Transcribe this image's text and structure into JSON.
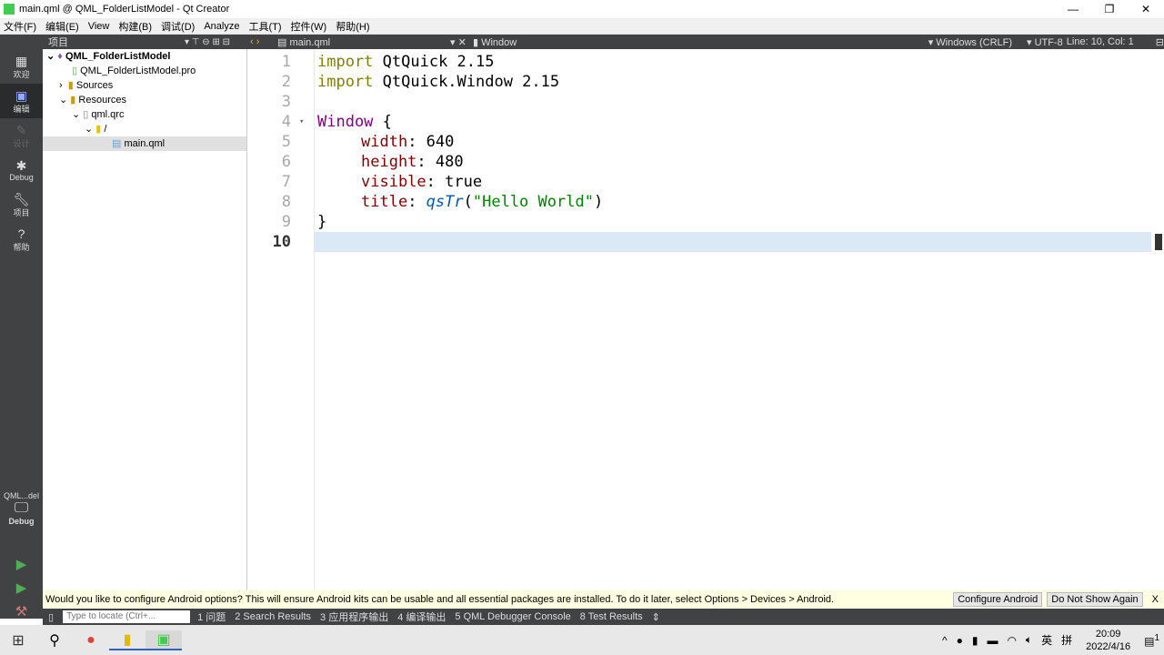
{
  "window": {
    "title": "main.qml @ QML_FolderListModel - Qt Creator",
    "logo": "QC"
  },
  "menu": [
    "文件(F)",
    "编辑(E)",
    "View",
    "构建(B)",
    "调试(D)",
    "Analyze",
    "工具(T)",
    "控件(W)",
    "帮助(H)"
  ],
  "modes": [
    {
      "label": "欢迎",
      "icon": "grid-icon"
    },
    {
      "label": "编辑",
      "icon": "edit-icon"
    },
    {
      "label": "设计",
      "icon": "pen-icon"
    },
    {
      "label": "Debug",
      "icon": "bug-icon"
    },
    {
      "label": "项目",
      "icon": "wrench-icon"
    },
    {
      "label": "帮助",
      "icon": "help-icon"
    }
  ],
  "kit": {
    "project": "QML...del",
    "config": "Debug"
  },
  "toolbar": {
    "panel_title": "项目",
    "file": "main.qml",
    "symbol": "Window",
    "line_ending": "Windows (CRLF)",
    "encoding": "UTF-8",
    "position": "Line: 10, Col: 1"
  },
  "tree": [
    {
      "label": "QML_FolderListModel",
      "depth": 0,
      "bold": true
    },
    {
      "label": "QML_FolderListModel.pro",
      "depth": 1
    },
    {
      "label": "Sources",
      "depth": 1
    },
    {
      "label": "Resources",
      "depth": 1
    },
    {
      "label": "qml.qrc",
      "depth": 2
    },
    {
      "label": "/",
      "depth": 3
    },
    {
      "label": "main.qml",
      "depth": 4
    }
  ],
  "code": {
    "lines": [
      "1",
      "2",
      "3",
      "4",
      "5",
      "6",
      "7",
      "8",
      "9",
      "10"
    ],
    "l1": [
      "import",
      " QtQuick 2.15"
    ],
    "l2": [
      "import",
      " QtQuick.Window 2.15"
    ],
    "l4": [
      "Window",
      " {"
    ],
    "l5": [
      "width",
      ": 640"
    ],
    "l6": [
      "height",
      ": 480"
    ],
    "l7": [
      "visible",
      ": true"
    ],
    "l8": [
      "title",
      ": ",
      "qsTr",
      "(",
      "\"Hello World\"",
      ")"
    ],
    "l9": "}"
  },
  "infobar": {
    "message": "Would you like to configure Android options? This will ensure Android kits can be usable and all essential packages are installed. To do it later, select Options > Devices > Android.",
    "configure": "Configure Android",
    "dismiss": "Do Not Show Again",
    "close": "X"
  },
  "output": {
    "locate_placeholder": "Type to locate (Ctrl+...",
    "tabs": [
      "1 问题",
      "2 Search Results",
      "3 应用程序输出",
      "4 编译输出",
      "5 QML Debugger Console",
      "8 Test Results"
    ]
  },
  "taskbar": {
    "ime1": "英",
    "ime2": "拼",
    "time": "20:09",
    "date": "2022/4/16",
    "notif": "1"
  }
}
